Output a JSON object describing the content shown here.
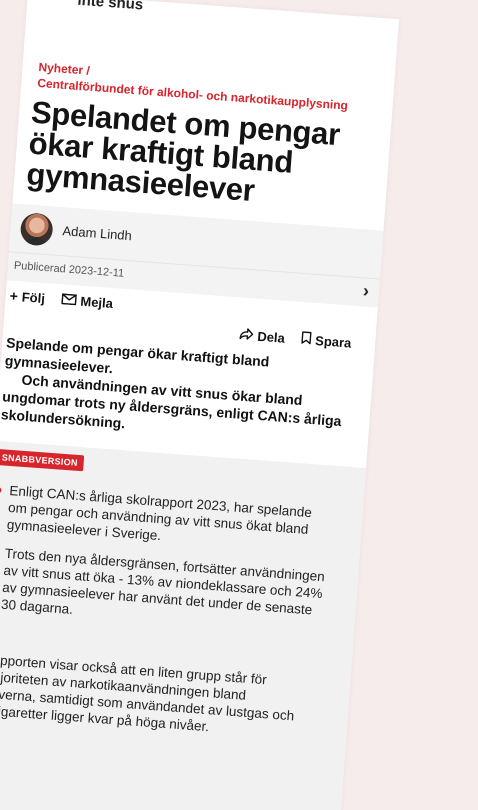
{
  "top_fragment": "inte snus",
  "breadcrumb": {
    "section": "Nyheter /",
    "source": "Centralförbundet för alkohol- och narkotikaupplysning"
  },
  "article": {
    "headline": "Spelandet om pengar ökar kraftigt bland gymnasieelever",
    "author": "Adam Lindh",
    "published": "Publicerad 2023-12-11",
    "lead_1": "Spelande om pengar ökar kraftigt bland gymnasieelever.",
    "lead_2": "Och användningen av vitt snus ökar bland ungdomar trots ny åldersgräns, enligt CAN:s årliga skolundersökning."
  },
  "actions": {
    "follow": "Följ",
    "mail": "Mejla",
    "share": "Dela",
    "save": "Spara"
  },
  "summary": {
    "badge": "SNABBVERSION",
    "bullets": [
      "Enligt CAN:s årliga skolrapport 2023, har spelande om pengar och användning av vitt snus ökat bland gymnasieelever i Sverige.",
      "Trots den nya åldersgränsen, fortsätter användningen av vitt snus att öka - 13% av niondeklassare och 24% av gymnasieelever har använt det under de senaste 30 dagarna."
    ],
    "paragraph": "Rapporten visar också att en liten grupp står för majoriteten av narkotikaanvändningen bland eleverna, samtidigt som användandet av lustgas och e-cigaretter ligger kvar på höga nivåer."
  },
  "colors": {
    "accent": "#d6252d",
    "background": "#f7ecec"
  }
}
